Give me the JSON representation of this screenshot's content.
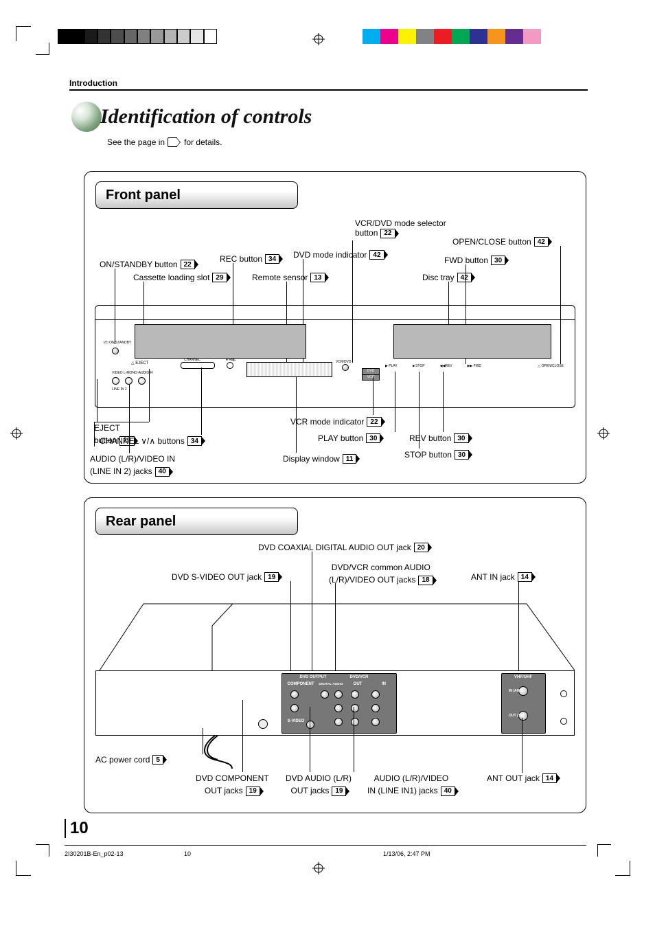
{
  "section": "Introduction",
  "title": "Identification of controls",
  "subtitle_before": "See the page in",
  "subtitle_after": "for details.",
  "panels": {
    "front": {
      "header": "Front panel",
      "callouts": {
        "on_standby": {
          "text": "ON/STANDBY button",
          "page": "22"
        },
        "cassette_slot": {
          "text": "Cassette loading slot",
          "page": "29"
        },
        "rec": {
          "text": "REC button",
          "page": "34"
        },
        "remote_sensor": {
          "text": "Remote sensor",
          "page": "13"
        },
        "dvd_mode_ind": {
          "text": "DVD mode indicator",
          "page": "42"
        },
        "vcr_dvd_sel_l1": "VCR/DVD mode selector",
        "vcr_dvd_sel_l2": "button",
        "vcr_dvd_sel_page": "22",
        "disc_tray": {
          "text": "Disc tray",
          "page": "42"
        },
        "open_close": {
          "text": "OPEN/CLOSE button",
          "page": "42"
        },
        "fwd": {
          "text": "FWD button",
          "page": "30"
        },
        "eject_l1": "EJECT",
        "eject_l2": "button",
        "eject_page": "29",
        "channel": {
          "text": "CHANNEL ∨/∧ buttons",
          "page": "34"
        },
        "audio_lr_l1": "AUDIO (L/R)/VIDEO IN",
        "audio_lr_l2": "(LINE IN 2) jacks",
        "audio_lr_page": "40",
        "display_window": {
          "text": "Display window",
          "page": "11"
        },
        "vcr_mode_ind": {
          "text": "VCR mode indicator",
          "page": "22"
        },
        "play": {
          "text": "PLAY button",
          "page": "30"
        },
        "stop": {
          "text": "STOP button",
          "page": "30"
        },
        "rev": {
          "text": "REV button",
          "page": "30"
        }
      },
      "device": {
        "power_label": "I/⏻ ON/STANDBY",
        "eject_label": "△ EJECT",
        "channel_label": "CHANNEL",
        "rec_label": "● REC",
        "jack_label": "VIDEO   L-MONO-AUDIO-R",
        "line2_label": "LINE IN 2",
        "ind_dvd": "DVD",
        "ind_vcr": "VCR",
        "btn_play": "▶ PLAY",
        "btn_stop": "■ STOP",
        "btn_rev": "◀◀REV",
        "btn_fwd": "▶▶ FWD",
        "open_close_label": "△ OPEN/CLOSE",
        "vcr_dvd_label": "VCR/DVD"
      }
    },
    "rear": {
      "header": "Rear panel",
      "callouts": {
        "coax": {
          "text": "DVD COAXIAL DIGITAL AUDIO OUT jack",
          "page": "20"
        },
        "svideo": {
          "text": "DVD S-VIDEO OUT jack",
          "page": "19"
        },
        "common_l1": "DVD/VCR common AUDIO",
        "common_l2": "(L/R)/VIDEO OUT jacks",
        "common_page": "18",
        "ant_in": {
          "text": "ANT IN jack",
          "page": "14"
        },
        "ac_cord": {
          "text": "AC power cord",
          "page": "5"
        },
        "component_l1": "DVD COMPONENT",
        "component_l2": "OUT jacks",
        "component_page": "19",
        "dvd_audio_l1": "DVD AUDIO (L/R)",
        "dvd_audio_l2": "OUT jacks",
        "dvd_audio_page": "19",
        "line1_l1": "AUDIO (L/R)/VIDEO",
        "line1_l2": "IN (LINE IN1) jacks",
        "line1_page": "40",
        "ant_out": {
          "text": "ANT OUT jack",
          "page": "14"
        }
      },
      "device": {
        "dvd_output": "DVD OUTPUT",
        "dvd_vcr": "DVD/VCR",
        "component": "COMPONENT",
        "digital_audio": "DIGITAL AUDIO",
        "svideo": "S-VIDEO",
        "vhf_uhf": "VHF/UHF",
        "in_ant": "IN (ANT.)",
        "out_tv": "OUT (TV)",
        "out": "OUT",
        "in": "IN"
      }
    }
  },
  "page_number": "10",
  "footer": {
    "doc_id": "2I30201B-En_p02-13",
    "page": "10",
    "timestamp": "1/13/06, 2:47 PM"
  },
  "bw_shades": [
    "#000000",
    "#000000",
    "#1a1a1a",
    "#333333",
    "#4d4d4d",
    "#666666",
    "#808080",
    "#999999",
    "#b3b3b3",
    "#cccccc",
    "#e6e6e6",
    "#ffffff"
  ],
  "color_swatches": [
    "#00aeef",
    "#ec008c",
    "#fff200",
    "#808285",
    "#ed1c24",
    "#00a651",
    "#2e3192",
    "#f7941d",
    "#662d91",
    "#f49ac1"
  ]
}
